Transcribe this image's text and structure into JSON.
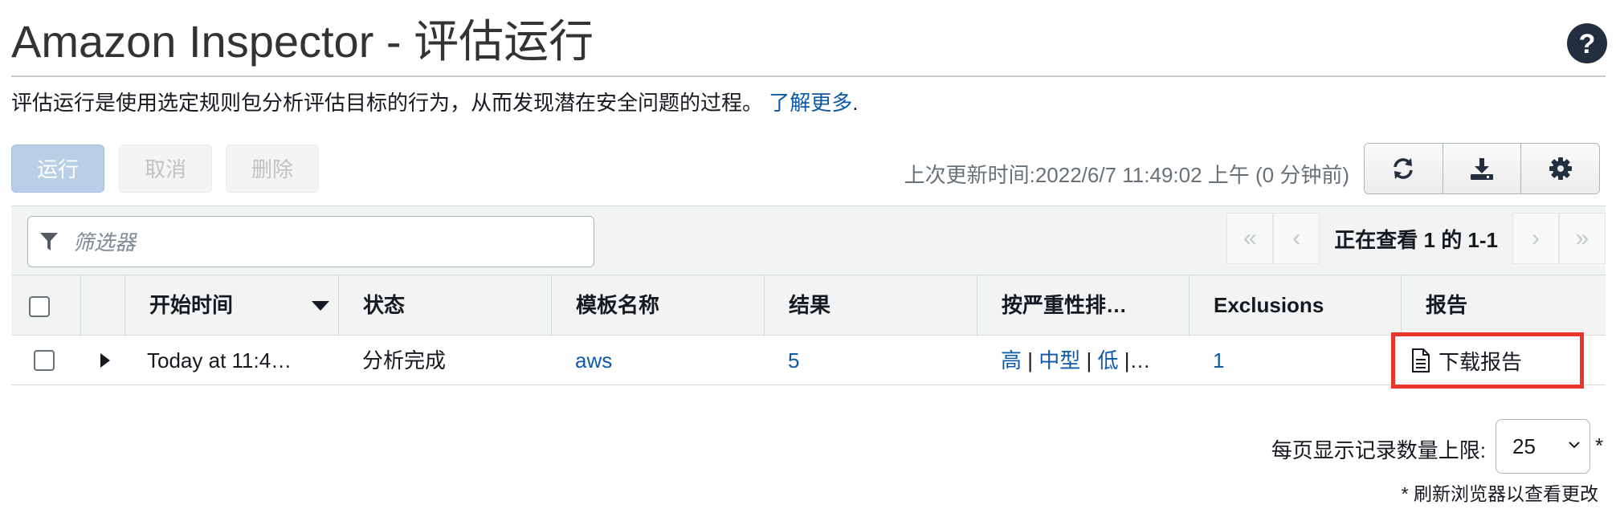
{
  "header": {
    "title": "Amazon Inspector - 评估运行",
    "help_icon": "question-circle-icon"
  },
  "description": {
    "text": "评估运行是使用选定规则包分析评估目标的行为，从而发现潜在安全问题的过程。",
    "link_label": "了解更多",
    "suffix": "."
  },
  "toolbar": {
    "run_label": "运行",
    "cancel_label": "取消",
    "delete_label": "删除",
    "last_updated": "上次更新时间:2022/6/7 11:49:02 上午 (0 分钟前)",
    "icons": [
      "refresh-icon",
      "download-icon",
      "settings-gear-icon"
    ]
  },
  "filter": {
    "placeholder": "筛选器",
    "icon": "filter-funnel-icon"
  },
  "pager": {
    "text": "正在查看 1 的 1-1",
    "first": "«",
    "prev": "‹",
    "next": "›",
    "last": "»"
  },
  "table": {
    "columns": [
      "开始时间",
      "状态",
      "模板名称",
      "结果",
      "按严重性排…",
      "Exclusions",
      "报告"
    ],
    "rows": [
      {
        "start_time": "Today at 11:4…",
        "status": "分析完成",
        "template": "aws",
        "findings": "5",
        "severity": {
          "high": "高",
          "medium": "中型",
          "low": "低",
          "sep": "|",
          "more": "|…"
        },
        "exclusions": "1",
        "report": "下载报告"
      }
    ]
  },
  "footer": {
    "per_page_label": "每页显示记录数量上限:",
    "per_page_value": "25",
    "asterisk": "*",
    "note": "* 刷新浏览器以查看更改"
  },
  "colors": {
    "link": "#0d5aa7",
    "highlight": "#e8372a",
    "run_button": "#b9cfe8"
  }
}
